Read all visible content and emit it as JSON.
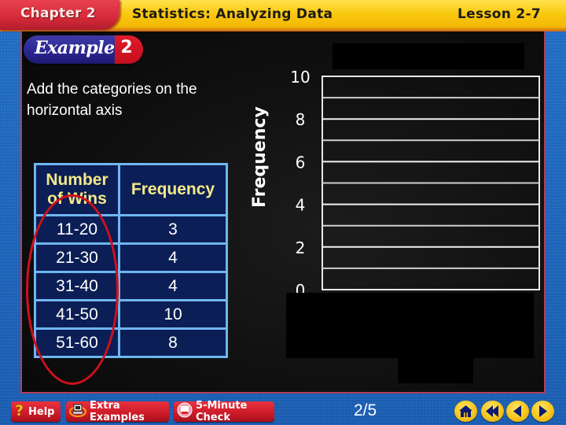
{
  "header": {
    "chapter": "Chapter 2",
    "title": "Statistics: Analyzing Data",
    "lesson": "Lesson 2-7"
  },
  "example": {
    "label": "Example",
    "number": "2"
  },
  "instruction": "Add the categories on the horizontal axis",
  "table": {
    "headers": [
      "Number of Wins",
      "Frequency"
    ],
    "rows": [
      {
        "wins": "11-20",
        "frequency": "3"
      },
      {
        "wins": "21-30",
        "frequency": "4"
      },
      {
        "wins": "31-40",
        "frequency": "4"
      },
      {
        "wins": "41-50",
        "frequency": "10"
      },
      {
        "wins": "51-60",
        "frequency": "8"
      }
    ],
    "highlight": "first-column-circled"
  },
  "chart_data": {
    "type": "bar",
    "title": "",
    "xlabel": "",
    "ylabel": "Frequency",
    "ylim": [
      0,
      10
    ],
    "yticks": [
      "0",
      "2",
      "4",
      "6",
      "8",
      "10"
    ],
    "grid": true,
    "grid_step": 1,
    "categories": [],
    "values": []
  },
  "footer": {
    "buttons": [
      {
        "label": "Help",
        "icon": "question-icon"
      },
      {
        "label": "Extra Examples",
        "icon": "computer-icon"
      },
      {
        "label": "5-Minute Check",
        "icon": "clipboard-icon"
      }
    ],
    "page": "2/5",
    "nav": [
      {
        "name": "home",
        "icon": "home-icon"
      },
      {
        "name": "first",
        "icon": "rewind-icon"
      },
      {
        "name": "previous",
        "icon": "previous-icon"
      },
      {
        "name": "next",
        "icon": "next-icon"
      }
    ]
  },
  "colors": {
    "header_red": "#d42a3a",
    "header_yellow": "#f9c80e",
    "table_bg": "#0b1e55",
    "table_border": "#6fb6f0",
    "table_header_text": "#f4e98a",
    "highlight_ellipse": "#d0101c",
    "nav_button": "#f6c51b"
  }
}
